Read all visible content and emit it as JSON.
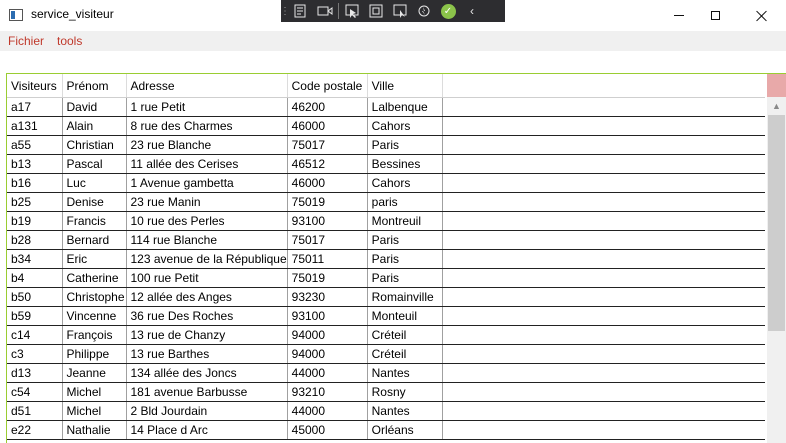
{
  "window": {
    "title": "service_visiteur",
    "icons": {
      "app": "window-icon",
      "minimize": "minimize-icon",
      "maximize": "maximize-icon",
      "close": "close-icon"
    }
  },
  "menu": {
    "items": [
      {
        "label": "Fichier"
      },
      {
        "label": "tools"
      }
    ],
    "color": "#c0392b"
  },
  "debug_toolbar": {
    "icons": [
      "grip-icon",
      "live-visual-tree-icon",
      "video-icon",
      "select-element-icon",
      "display-adorners-icon",
      "track-focus-icon",
      "hot-reload-icon",
      "checkmark-icon",
      "collapse-icon"
    ]
  },
  "grid": {
    "columns": [
      "Visiteurs",
      "Prénom",
      "Adresse",
      "Code postale",
      "Ville"
    ],
    "rows": [
      [
        "a17",
        "David",
        "1 rue Petit",
        "46200",
        "Lalbenque"
      ],
      [
        "a131",
        "Alain",
        "8 rue des Charmes",
        "46000",
        "Cahors"
      ],
      [
        "a55",
        "Christian",
        "23 rue Blanche",
        "75017",
        "Paris"
      ],
      [
        "b13",
        "Pascal",
        "11 allée des Cerises",
        "46512",
        "Bessines"
      ],
      [
        "b16",
        "Luc",
        "1 Avenue gambetta",
        "46000",
        "Cahors"
      ],
      [
        "b25",
        "Denise",
        "23 rue Manin",
        "75019",
        "paris"
      ],
      [
        "b19",
        "Francis",
        "10 rue des Perles",
        "93100",
        "Montreuil"
      ],
      [
        "b28",
        "Bernard",
        "114 rue Blanche",
        "75017",
        "Paris"
      ],
      [
        "b34",
        "Eric",
        "123 avenue de la République",
        "75011",
        "Paris"
      ],
      [
        "b4",
        "Catherine",
        "100 rue Petit",
        "75019",
        "Paris"
      ],
      [
        "b50",
        "Christophe",
        "12 allée des Anges",
        "93230",
        "Romainville"
      ],
      [
        "b59",
        "Vincenne",
        "36 rue Des Roches",
        "93100",
        "Monteuil"
      ],
      [
        "c14",
        "François",
        "13 rue de Chanzy",
        "94000",
        "Créteil"
      ],
      [
        "c3",
        "Philippe",
        "13 rue Barthes",
        "94000",
        "Créteil"
      ],
      [
        "d13",
        "Jeanne",
        "134 allée des Joncs",
        "44000",
        "Nantes"
      ],
      [
        "c54",
        "Michel",
        "181 avenue Barbusse",
        "93210",
        "Rosny"
      ],
      [
        "d51",
        "Michel",
        "2 Bld Jourdain",
        "44000",
        "Nantes"
      ],
      [
        "e22",
        "Nathalie",
        "14 Place d Arc",
        "45000",
        "Orléans"
      ]
    ],
    "accent_border": "#9acd32"
  }
}
